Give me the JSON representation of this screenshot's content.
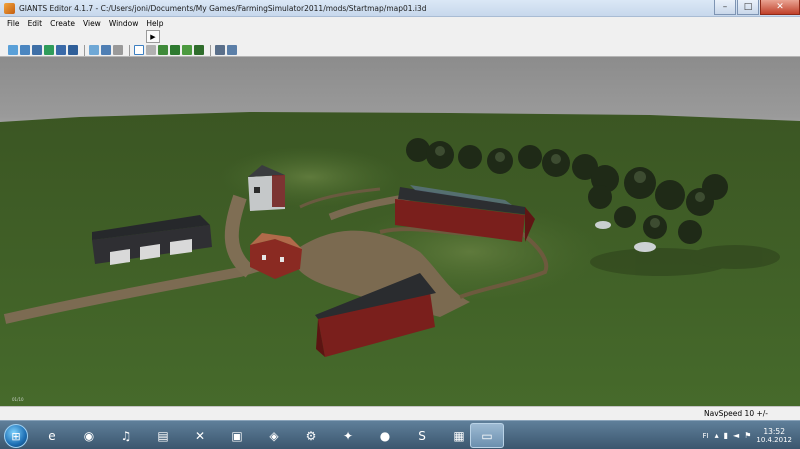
{
  "window": {
    "title": "GIANTS Editor 4.1.7 - C:/Users/joni/Documents/My Games/FarmingSimulator2011/mods/Startmap/map01.i3d",
    "minimize": "–",
    "maximize": "□",
    "close": "✕"
  },
  "menu": {
    "file": "File",
    "edit": "Edit",
    "create": "Create",
    "view": "View",
    "window": "Window",
    "help": "Help"
  },
  "toolbar": {
    "play": "▶",
    "icons": [
      "new-icon",
      "open-icon",
      "save-icon",
      "import-icon",
      "export-icon",
      "save-all-icon",
      "copy-icon",
      "undo-icon",
      "redo-icon",
      "select-icon",
      "move-icon",
      "terrain-sculpt-icon",
      "terrain-paint-icon",
      "foliage-paint-icon",
      "terrain-smooth-icon",
      "settings-icon",
      "script-icon"
    ]
  },
  "viewport": {
    "corner_label": "01/10"
  },
  "status": {
    "navspeed": "NavSpeed 10 +/-"
  },
  "taskbar": {
    "lang": "FI",
    "time": "13:52",
    "date": "10.4.2012",
    "apps": [
      "internet-explorer-icon",
      "chrome-icon",
      "winamp-icon",
      "folder-icon",
      "tools-icon",
      "monitor-icon",
      "giants-icon",
      "tractor-icon",
      "game-icon",
      "xbox-icon",
      "skype-icon",
      "terminal-icon",
      "giants-editor-icon"
    ]
  },
  "colors": {
    "grass": "#3f5b26",
    "dirt": "#7c6b52",
    "barn_red": "#7a1f1c",
    "roof": "#2c2e31"
  }
}
